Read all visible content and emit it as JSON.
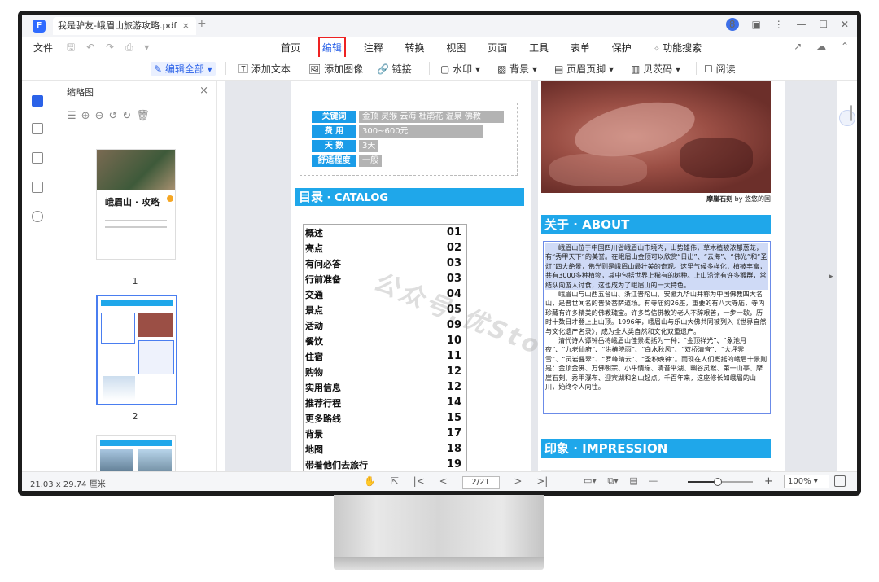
{
  "titlebar": {
    "doc_tab": "我是驴友-峨眉山旅游攻略.pdf",
    "close": "×",
    "new_tab": "+"
  },
  "menu": {
    "file": "文件",
    "items": [
      "首页",
      "编辑",
      "注释",
      "转换",
      "视图",
      "页面",
      "工具",
      "表单",
      "保护"
    ],
    "active": "编辑",
    "search": "功能搜索"
  },
  "toolbar": {
    "edit_all": "编辑全部",
    "add_text": "添加文本",
    "add_image": "添加图像",
    "link": "链接",
    "watermark": "水印",
    "background": "背景",
    "header_footer": "页眉页脚",
    "bates": "贝茨码",
    "read": "阅读"
  },
  "thumbs": {
    "title": "缩略图",
    "close": "×",
    "page1_title": "峨眉山 · 攻略",
    "pages": [
      "1",
      "2"
    ]
  },
  "info": {
    "rows": [
      {
        "key": "关键词",
        "value": "金顶 灵猴 云海 杜鹃花 温泉 佛教"
      },
      {
        "key": "费 用",
        "value": "300~600元"
      },
      {
        "key": "天 数",
        "value": "3天"
      },
      {
        "key": "舒适程度",
        "value": "一般"
      }
    ]
  },
  "catalog": {
    "title_cn": "目录",
    "title_en": " · CATALOG",
    "items": [
      {
        "label": "概述",
        "page": "01"
      },
      {
        "label": "亮点",
        "page": "02"
      },
      {
        "label": "有问必答",
        "page": "03"
      },
      {
        "label": "行前准备",
        "page": "03"
      },
      {
        "label": "交通",
        "page": "04"
      },
      {
        "label": "景点",
        "page": "05"
      },
      {
        "label": "活动",
        "page": "09"
      },
      {
        "label": "餐饮",
        "page": "10"
      },
      {
        "label": "住宿",
        "page": "11"
      },
      {
        "label": "购物",
        "page": "12"
      },
      {
        "label": "实用信息",
        "page": "12"
      },
      {
        "label": "推荐行程",
        "page": "14"
      },
      {
        "label": "更多路线",
        "page": "15"
      },
      {
        "label": "背景",
        "page": "17"
      },
      {
        "label": "地图",
        "page": "18"
      },
      {
        "label": "带着他们去旅行",
        "page": "19"
      }
    ]
  },
  "watermark": "公众号:优Store",
  "photo_caption": {
    "name": "摩崖石刻",
    "by": " by 悠悠的国"
  },
  "about": {
    "title_cn": "关于",
    "title_en": " · ABOUT",
    "p1": "峨眉山位于中国四川省峨眉山市境内，山势雄伟，草木植被浓郁葱茏，有“秀甲天下”的美誉。在峨眉山金顶可以欣赏“日出”、“云海”、“佛光”和“圣灯”四大绝景，佛光则是峨眉山最壮美的奇观。这里气候多样化，植被丰富，共有3000多种植物，其中包括世界上稀有的树种。上山沿途有许多猴群，常结队向游人讨食，这也成为了峨眉山的一大特色。",
    "p2": "峨眉山与山西五台山、浙江普陀山、安徽九华山并称为中国佛教四大名山，是普世闻名的普贤菩萨道场。有寺庙约26座，重要的有八大寺庙，寺内珍藏有许多精美的佛教瑰宝。许多笃信佛教的老人不辞艰苦，一步一歇，历时十数日才登上上山顶。1996年，峨眉山与乐山大佛共同被列入《世界自然与文化遗产名录》，成为全人类自然和文化双重遗产。",
    "p3": "清代诗人谭钟岳将峨眉山佳景概括为十种：“金顶祥光”、“象池月夜”、“九老仙府”、“洪椿晓雨”、“白水秋风”、“双桥清音”、“大坪霁雪”、“灵岩叠翠”、“罗峰晴云”、“圣积晚钟”。而现在人们概括的峨眉十景则是：金顶金佛、万佛朝宗、小平情缘、清音平湖、幽谷灵猴、第一山亭、摩崖石刻、秀甲瀑布、迎宾湖和名山起点。千百年来，这座修长如峨眉的山川，始终令人向往。"
  },
  "impression": {
    "title_cn": "印象",
    "title_en": " · IMPRESSION"
  },
  "status": {
    "page_size": "21.03 x 29.74 厘米",
    "page_indicator": "2/21",
    "zoom": "100%"
  },
  "colors": {
    "accent": "#2b62e8",
    "section_bar": "#1fa7ea"
  }
}
